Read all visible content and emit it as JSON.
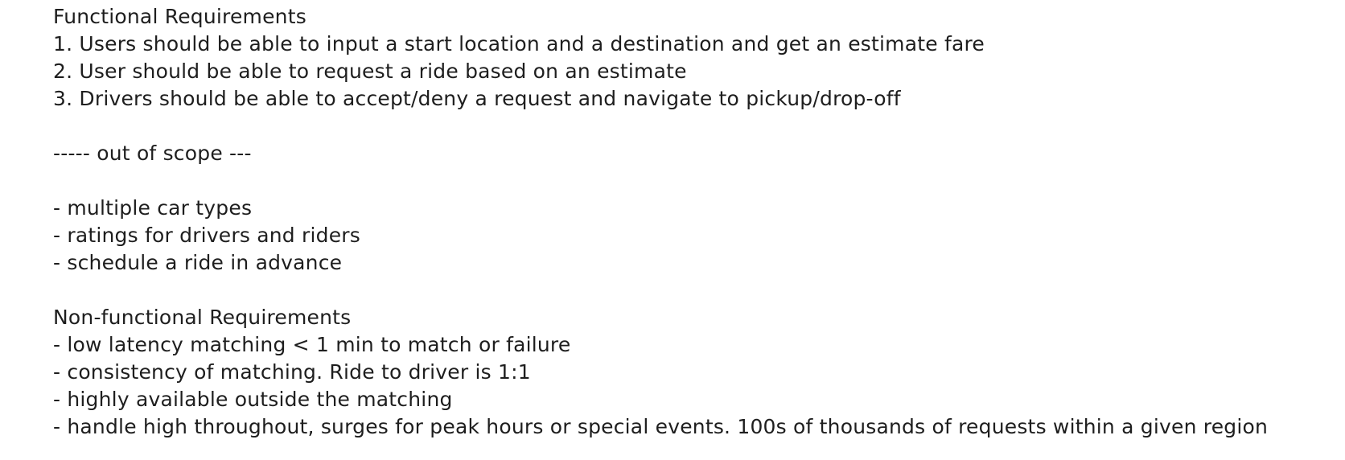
{
  "functional": {
    "heading": "Functional Requirements",
    "items": [
      "1. Users should be able to input a start location and a destination and get an estimate fare",
      "2. User should be able to request a ride based on an estimate",
      "3. Drivers should be able to accept/deny a request and navigate to pickup/drop-off"
    ]
  },
  "out_of_scope": {
    "heading": "----- out of scope ---",
    "items": [
      "- multiple car types",
      "- ratings for drivers and riders",
      "- schedule a ride in advance"
    ]
  },
  "non_functional": {
    "heading": "Non-functional Requirements",
    "items": [
      "- low latency matching < 1 min to match or failure",
      "- consistency of matching. Ride to driver is 1:1",
      "- highly available outside the matching",
      "- handle high throughout, surges for peak hours or special events. 100s of thousands of requests within a given region"
    ]
  }
}
